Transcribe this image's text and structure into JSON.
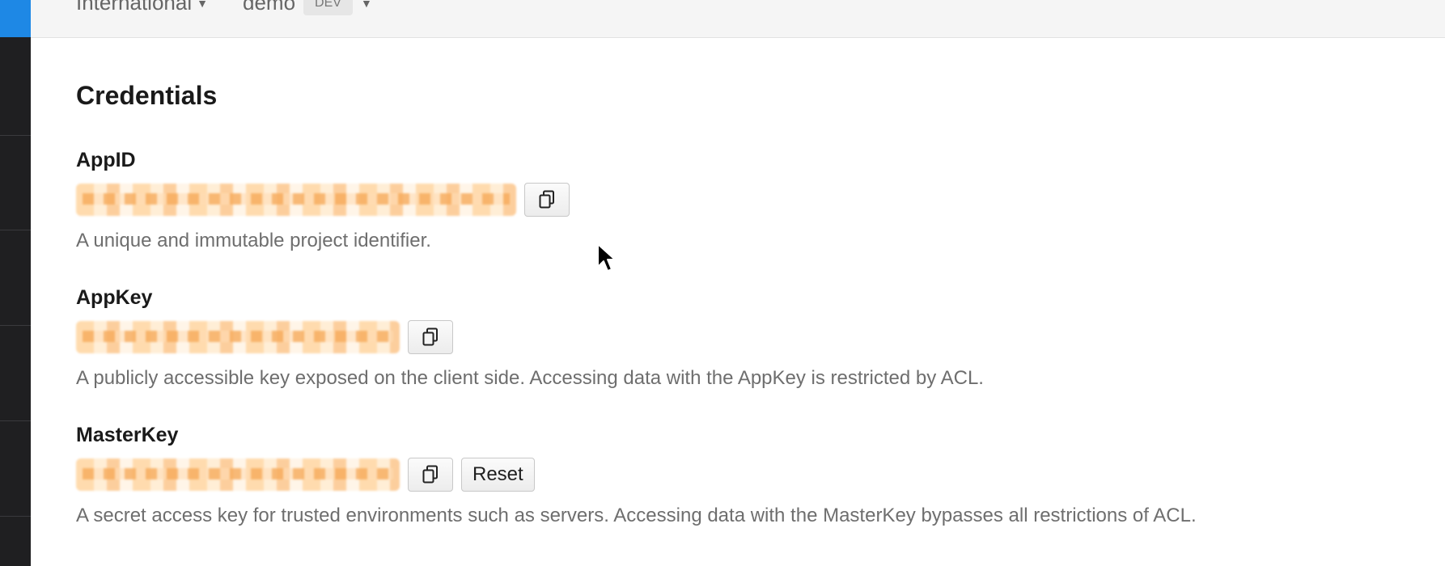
{
  "header": {
    "region_label": "International",
    "app_name": "demo",
    "env_badge": "DEV"
  },
  "page": {
    "title": "Credentials"
  },
  "credentials": [
    {
      "label": "AppID",
      "value_redacted": true,
      "copy_icon": "copy-icon",
      "description": "A unique and immutable project identifier."
    },
    {
      "label": "AppKey",
      "value_redacted": true,
      "copy_icon": "copy-icon",
      "description": "A publicly accessible key exposed on the client side. Accessing data with the AppKey is restricted by ACL."
    },
    {
      "label": "MasterKey",
      "value_redacted": true,
      "copy_icon": "copy-icon",
      "reset_label": "Reset",
      "description": "A secret access key for trusted environments such as servers. Accessing data with the MasterKey bypasses all restrictions of ACL."
    }
  ],
  "colors": {
    "sidebar_bg": "#1f1f21",
    "sidebar_accent": "#1e88e5",
    "redaction": "#f8b36b",
    "text_muted": "#6e6e6e"
  }
}
